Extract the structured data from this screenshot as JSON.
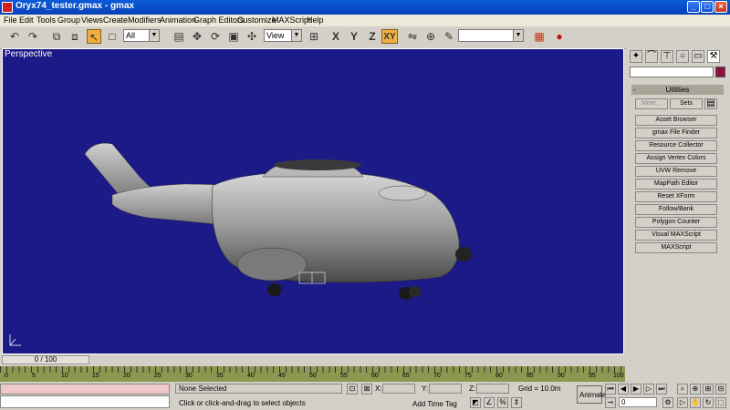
{
  "window": {
    "title": "Oryx74_tester.gmax - gmax",
    "controls": [
      "_",
      "□",
      "×"
    ]
  },
  "menu": [
    "File",
    "Edit",
    "Tools",
    "Group",
    "Views",
    "Create",
    "Modifiers",
    "Animation",
    "Graph Editors",
    "Customize",
    "MAXScript",
    "Help"
  ],
  "toolbar": {
    "selection_filter": "All",
    "ref_coord": "View",
    "axis_x": "X",
    "axis_y": "Y",
    "axis_z": "Z",
    "axis_xy": "XY",
    "named_selection": ""
  },
  "viewport": {
    "label": "Perspective",
    "background": "#1c1a86"
  },
  "command_panel": {
    "rollout_title": "Utilities",
    "rollout_toggle": "-",
    "more_label": "More...",
    "sets_label": "Sets",
    "utilities": [
      "Asset Browser",
      "gmax File Finder",
      "Resource Collector",
      "Assign Vertex Colors",
      "UVW Remove",
      "MapPath Editor",
      "Reset XForm",
      "Follow/Bank",
      "Polygon Counter",
      "Visual MAXScript",
      "MAXScript"
    ]
  },
  "timeline": {
    "frame_display": "0 / 100",
    "ticks": [
      "0",
      "5",
      "10",
      "15",
      "20",
      "25",
      "30",
      "35",
      "40",
      "45",
      "50",
      "55",
      "60",
      "65",
      "70",
      "75",
      "80",
      "85",
      "90",
      "95",
      "100"
    ]
  },
  "status": {
    "selection": "None Selected",
    "prompt": "Click or click-and-drag to select objects",
    "x_label": "X:",
    "y_label": "Y:",
    "z_label": "Z:",
    "grid": "Grid = 10.0m",
    "add_time_tag": "Add Time Tag",
    "animate": "Animate",
    "frame": "0"
  }
}
